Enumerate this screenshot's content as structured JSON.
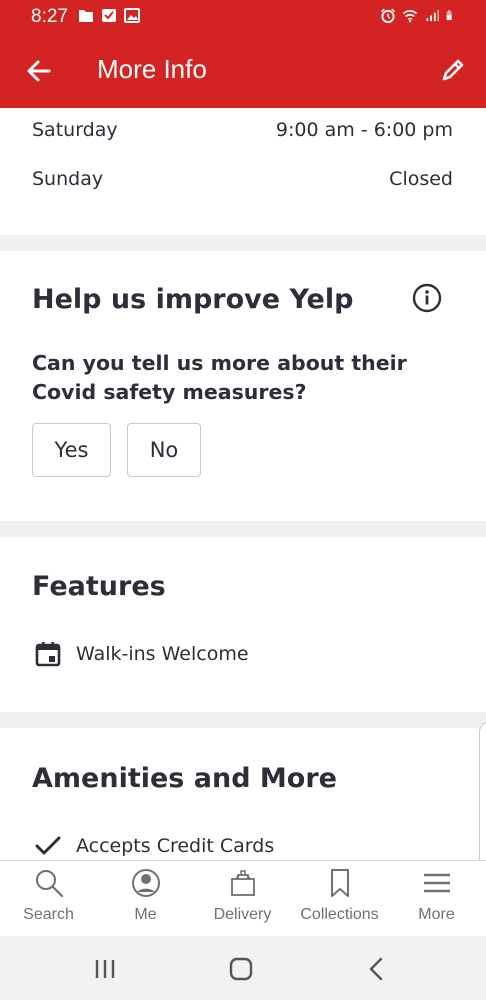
{
  "status_bar": {
    "time": "8:27",
    "left_icons": [
      "folder-icon",
      "checkbox-icon",
      "image-icon"
    ],
    "right_icons": [
      "alarm-icon",
      "wifi-icon",
      "signal-icon",
      "battery-icon"
    ]
  },
  "app_bar": {
    "title": "More Info",
    "back_icon": "arrow-left-icon",
    "edit_icon": "pencil-icon",
    "background": "#d32323"
  },
  "hours": [
    {
      "day": "Saturday",
      "time": "9:00 am - 6:00 pm"
    },
    {
      "day": "Sunday",
      "time": "Closed"
    }
  ],
  "improve": {
    "heading": "Help us improve Yelp",
    "question": "Can you tell us more about their Covid safety measures?",
    "yes_label": "Yes",
    "no_label": "No"
  },
  "features": {
    "heading": "Features",
    "items": [
      {
        "label": "Walk-ins Welcome",
        "icon": "calendar-icon"
      }
    ]
  },
  "amenities": {
    "heading": "Amenities and More",
    "items": [
      {
        "label": "Accepts Credit Cards",
        "icon": "checkmark-icon"
      }
    ]
  },
  "bottom_nav": [
    {
      "label": "Search",
      "icon": "search-icon"
    },
    {
      "label": "Me",
      "icon": "user-icon"
    },
    {
      "label": "Delivery",
      "icon": "shopping-bag-icon"
    },
    {
      "label": "Collections",
      "icon": "bookmark-icon"
    },
    {
      "label": "More",
      "icon": "menu-icon"
    }
  ]
}
